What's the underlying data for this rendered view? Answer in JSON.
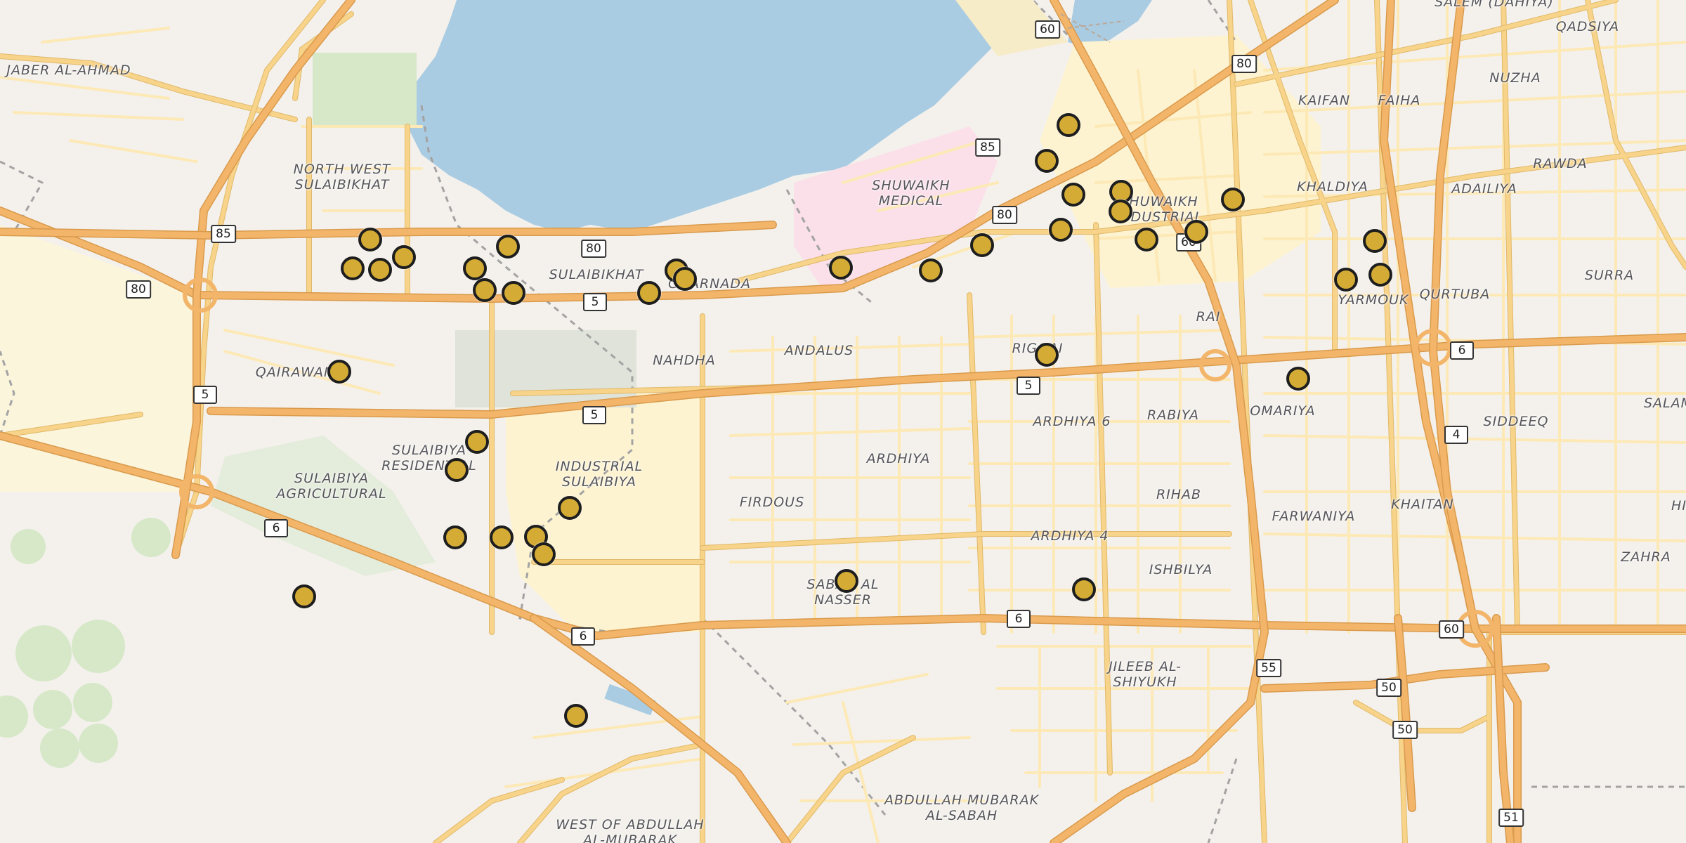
{
  "map": {
    "colors": {
      "water": "#aacce2",
      "land": "#f4f1ec",
      "medical_zone": "#fbe0ea",
      "industrial_zone": "#fdf3d0",
      "park": "#d6e8c8",
      "marker_fill": "#d4ac35",
      "marker_stroke": "#1e1e1e"
    },
    "area_labels": [
      {
        "text": "JABER AL-AHMAD"
      },
      {
        "text": "NORTH WEST\nSULAIBIKHAT"
      },
      {
        "text": "SHUWAIKH\nMEDICAL"
      },
      {
        "text": "SHUWAIKH\nINDUSTRIAL"
      },
      {
        "text": "SALEM (DAHIYA)"
      },
      {
        "text": "QADSIYA"
      },
      {
        "text": "KAIFAN"
      },
      {
        "text": "FAIHA"
      },
      {
        "text": "NUZHA"
      },
      {
        "text": "KHALDIYA"
      },
      {
        "text": "ADAILIYA"
      },
      {
        "text": "RAWDA"
      },
      {
        "text": "YARMOUK"
      },
      {
        "text": "QURTUBA"
      },
      {
        "text": "SURRA"
      },
      {
        "text": "SULAIBIKHAT"
      },
      {
        "text": "GHARNADA"
      },
      {
        "text": "NAHDHA"
      },
      {
        "text": "ANDALUS"
      },
      {
        "text": "RIGGAI"
      },
      {
        "text": "RAI"
      },
      {
        "text": "QAIRAWAN"
      },
      {
        "text": "SULAIBIYA\nRESIDENTIAL"
      },
      {
        "text": "INDUSTRIAL\nSULAIBIYA"
      },
      {
        "text": "SULAIBIYA\nAGRICULTURAL"
      },
      {
        "text": "FIRDOUS"
      },
      {
        "text": "ARDHIYA"
      },
      {
        "text": "ARDHIYA 6"
      },
      {
        "text": "RABIYA"
      },
      {
        "text": "OMARIYA"
      },
      {
        "text": "SIDDEEQ"
      },
      {
        "text": "SALAM"
      },
      {
        "text": "RIHAB"
      },
      {
        "text": "FARWANIYA"
      },
      {
        "text": "KHAITAN"
      },
      {
        "text": "ZAHRA"
      },
      {
        "text": "HI"
      },
      {
        "text": "ARDHIYA 4"
      },
      {
        "text": "ISHBILYA"
      },
      {
        "text": "SABAH AL\nNASSER"
      },
      {
        "text": "JILEEB AL-\nSHIYUKH"
      },
      {
        "text": "ABDULLAH MUBARAK\nAL-SABAH"
      },
      {
        "text": "WEST OF ABDULLAH\nAL-MUBARAK"
      }
    ],
    "road_shields": [
      "60",
      "80",
      "85",
      "80",
      "85",
      "80",
      "80",
      "5",
      "5",
      "5",
      "5",
      "6",
      "6",
      "6",
      "6",
      "60",
      "55",
      "50",
      "50",
      "4",
      "60",
      "51"
    ],
    "markers_count_label": ""
  }
}
